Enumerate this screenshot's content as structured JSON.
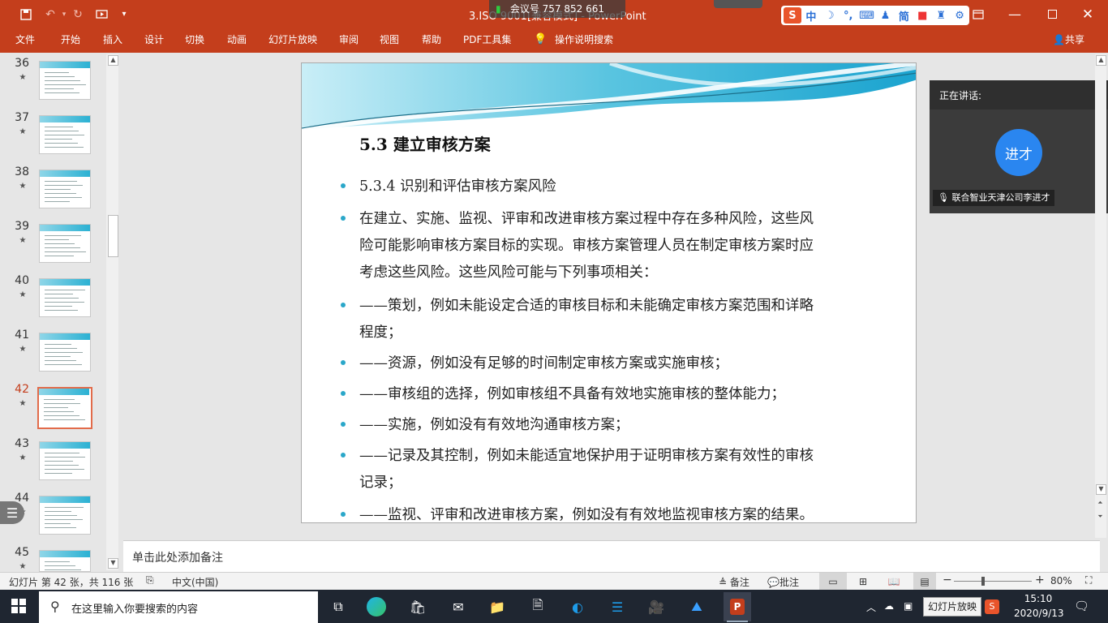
{
  "titlebar": {
    "doc_title": "3.ISO 9001[兼容模式] - PowerPoint",
    "meeting_id": "会议号 757 852 661"
  },
  "ime": {
    "icons": [
      "sogou-icon",
      "中",
      "moon-icon",
      "punct-icon",
      "keyboard-icon",
      "user-icon",
      "简",
      "record-icon",
      "shirt-icon",
      "gear-icon"
    ]
  },
  "menu": {
    "items": [
      "文件",
      "开始",
      "插入",
      "设计",
      "切换",
      "动画",
      "幻灯片放映",
      "审阅",
      "视图",
      "帮助",
      "PDF工具集",
      "操作说明搜索"
    ],
    "share": "共享"
  },
  "thumbnails": [
    {
      "num": "36",
      "star": "★"
    },
    {
      "num": "37",
      "star": "★"
    },
    {
      "num": "38",
      "star": "★"
    },
    {
      "num": "39",
      "star": "★"
    },
    {
      "num": "40",
      "star": "★"
    },
    {
      "num": "41",
      "star": "★"
    },
    {
      "num": "42",
      "star": "★"
    },
    {
      "num": "43",
      "star": "★"
    },
    {
      "num": "44",
      "star": "★"
    },
    {
      "num": "45",
      "star": "★"
    }
  ],
  "slide": {
    "title": "5.3 建立审核方案",
    "lines": [
      "5.3.4 识别和评估审核方案风险",
      "在建立、实施、监视、评审和改进审核方案过程中存在多种风险，这些风",
      "险可能影响审核方案目标的实现。审核方案管理人员在制定审核方案时应",
      "考虑这些风险。这些风险可能与下列事项相关：",
      "——策划，例如未能设定合适的审核目标和未能确定审核方案范围和详略",
      "程度；",
      "——资源，例如没有足够的时间制定审核方案或实施审核；",
      "——审核组的选择，例如审核组不具备有效地实施审核的整体能力；",
      "——实施，例如没有有效地沟通审核方案；",
      "——记录及其控制，例如未能适宜地保护用于证明审核方案有效性的审核",
      "记录；",
      "——监视、评审和改进审核方案，例如没有有效地监视审核方案的结果。"
    ]
  },
  "notes": {
    "placeholder": "单击此处添加备注"
  },
  "speaker": {
    "label": "正在讲话:",
    "avatar_text": "进才",
    "name": "联合智业天津公司李进才"
  },
  "status": {
    "slide_info": "幻灯片 第 42 张，共 116 张",
    "language": "中文(中国)",
    "notes": "备注",
    "comments": "批注",
    "zoom": "80%",
    "tooltip": "幻灯片放映"
  },
  "taskbar": {
    "search_placeholder": "在这里输入你要搜索的内容",
    "time": "15:10",
    "date": "2020/9/13"
  },
  "colors": {
    "accent": "#c43e1c",
    "bullet": "#2aa7c9",
    "avatar": "#2a86f0"
  }
}
